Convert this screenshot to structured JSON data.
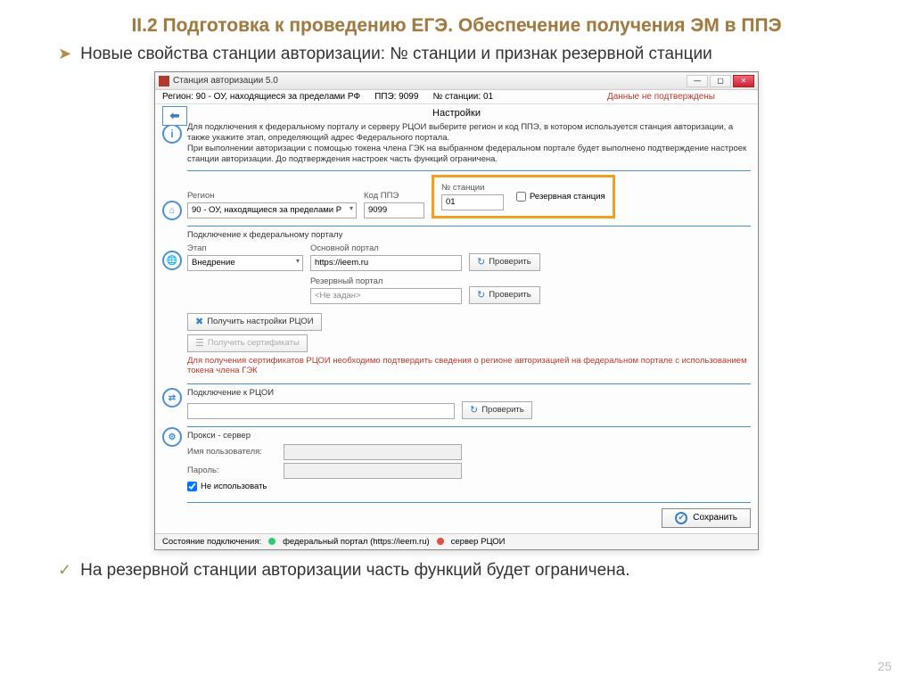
{
  "slide": {
    "bg_title": "II.2 Подготовка к проведению ЕГЭ. Обеспечение получения ЭМ в ППЭ",
    "title": "II.2 Подготовка к проведению ЕГЭ. Обеспечение получения ЭМ в ППЭ",
    "bullet1": "Новые свойства станции авторизации: № станции и признак резервной станции",
    "bullet2": "На резервной станции авторизации часть функций будет ограничена.",
    "pagenum": "25"
  },
  "win": {
    "title": "Станция авторизации 5.0",
    "min": "—",
    "max": "▢",
    "close": "✕",
    "info": {
      "region": "Регион: 90 - ОУ, находящиеся за пределами РФ",
      "ppe": "ППЭ: 9099",
      "station": "№ станции: 01",
      "warn": "Данные не подтверждены"
    },
    "header": "Настройки",
    "back": "⬅",
    "info_text": "Для подключения к федеральному порталу и серверу РЦОИ выберите регион и код ППЭ, в котором используется станция авторизации, а также укажите этап, определяющий адрес Федерального портала.\nПри выполнении авторизации с помощью токена члена ГЭК на выбранном федеральном портале будет выполнено подтверждение настроек станции авторизации. До подтверждения настроек часть функций ограничена.",
    "grp_region": {
      "region_lbl": "Регион",
      "region_val": "90 - ОУ, находящиеся за пределами Р",
      "ppe_lbl": "Код ППЭ",
      "ppe_val": "9099",
      "station_lbl": "№ станции",
      "station_val": "01",
      "reserve_lbl": "Резервная станция"
    },
    "grp_portal": {
      "title": "Подключение к федеральному порталу",
      "stage_lbl": "Этап",
      "stage_val": "Внедрение",
      "main_lbl": "Основной портал",
      "main_val": "https://ieem.ru",
      "reserve_lbl": "Резервный портал",
      "reserve_val": "<Не задан>",
      "check_btn": "Проверить",
      "get_settings": "Получить настройки РЦОИ",
      "get_certs": "Получить сертификаты",
      "warn": "Для получения сертификатов РЦОИ необходимо подтвердить сведения о регионе авторизацией на федеральном портале с использованием токена члена ГЭК"
    },
    "grp_rcoi": {
      "title": "Подключение к РЦОИ",
      "check_btn": "Проверить"
    },
    "grp_proxy": {
      "title": "Прокси - сервер",
      "user_lbl": "Имя пользователя:",
      "pass_lbl": "Пароль:",
      "nouse_lbl": "Не использовать"
    },
    "save": "Сохранить",
    "status": {
      "label": "Состояние подключения:",
      "fed": "федеральный портал (https://ieem.ru)",
      "rcoi": "сервер РЦОИ"
    }
  }
}
